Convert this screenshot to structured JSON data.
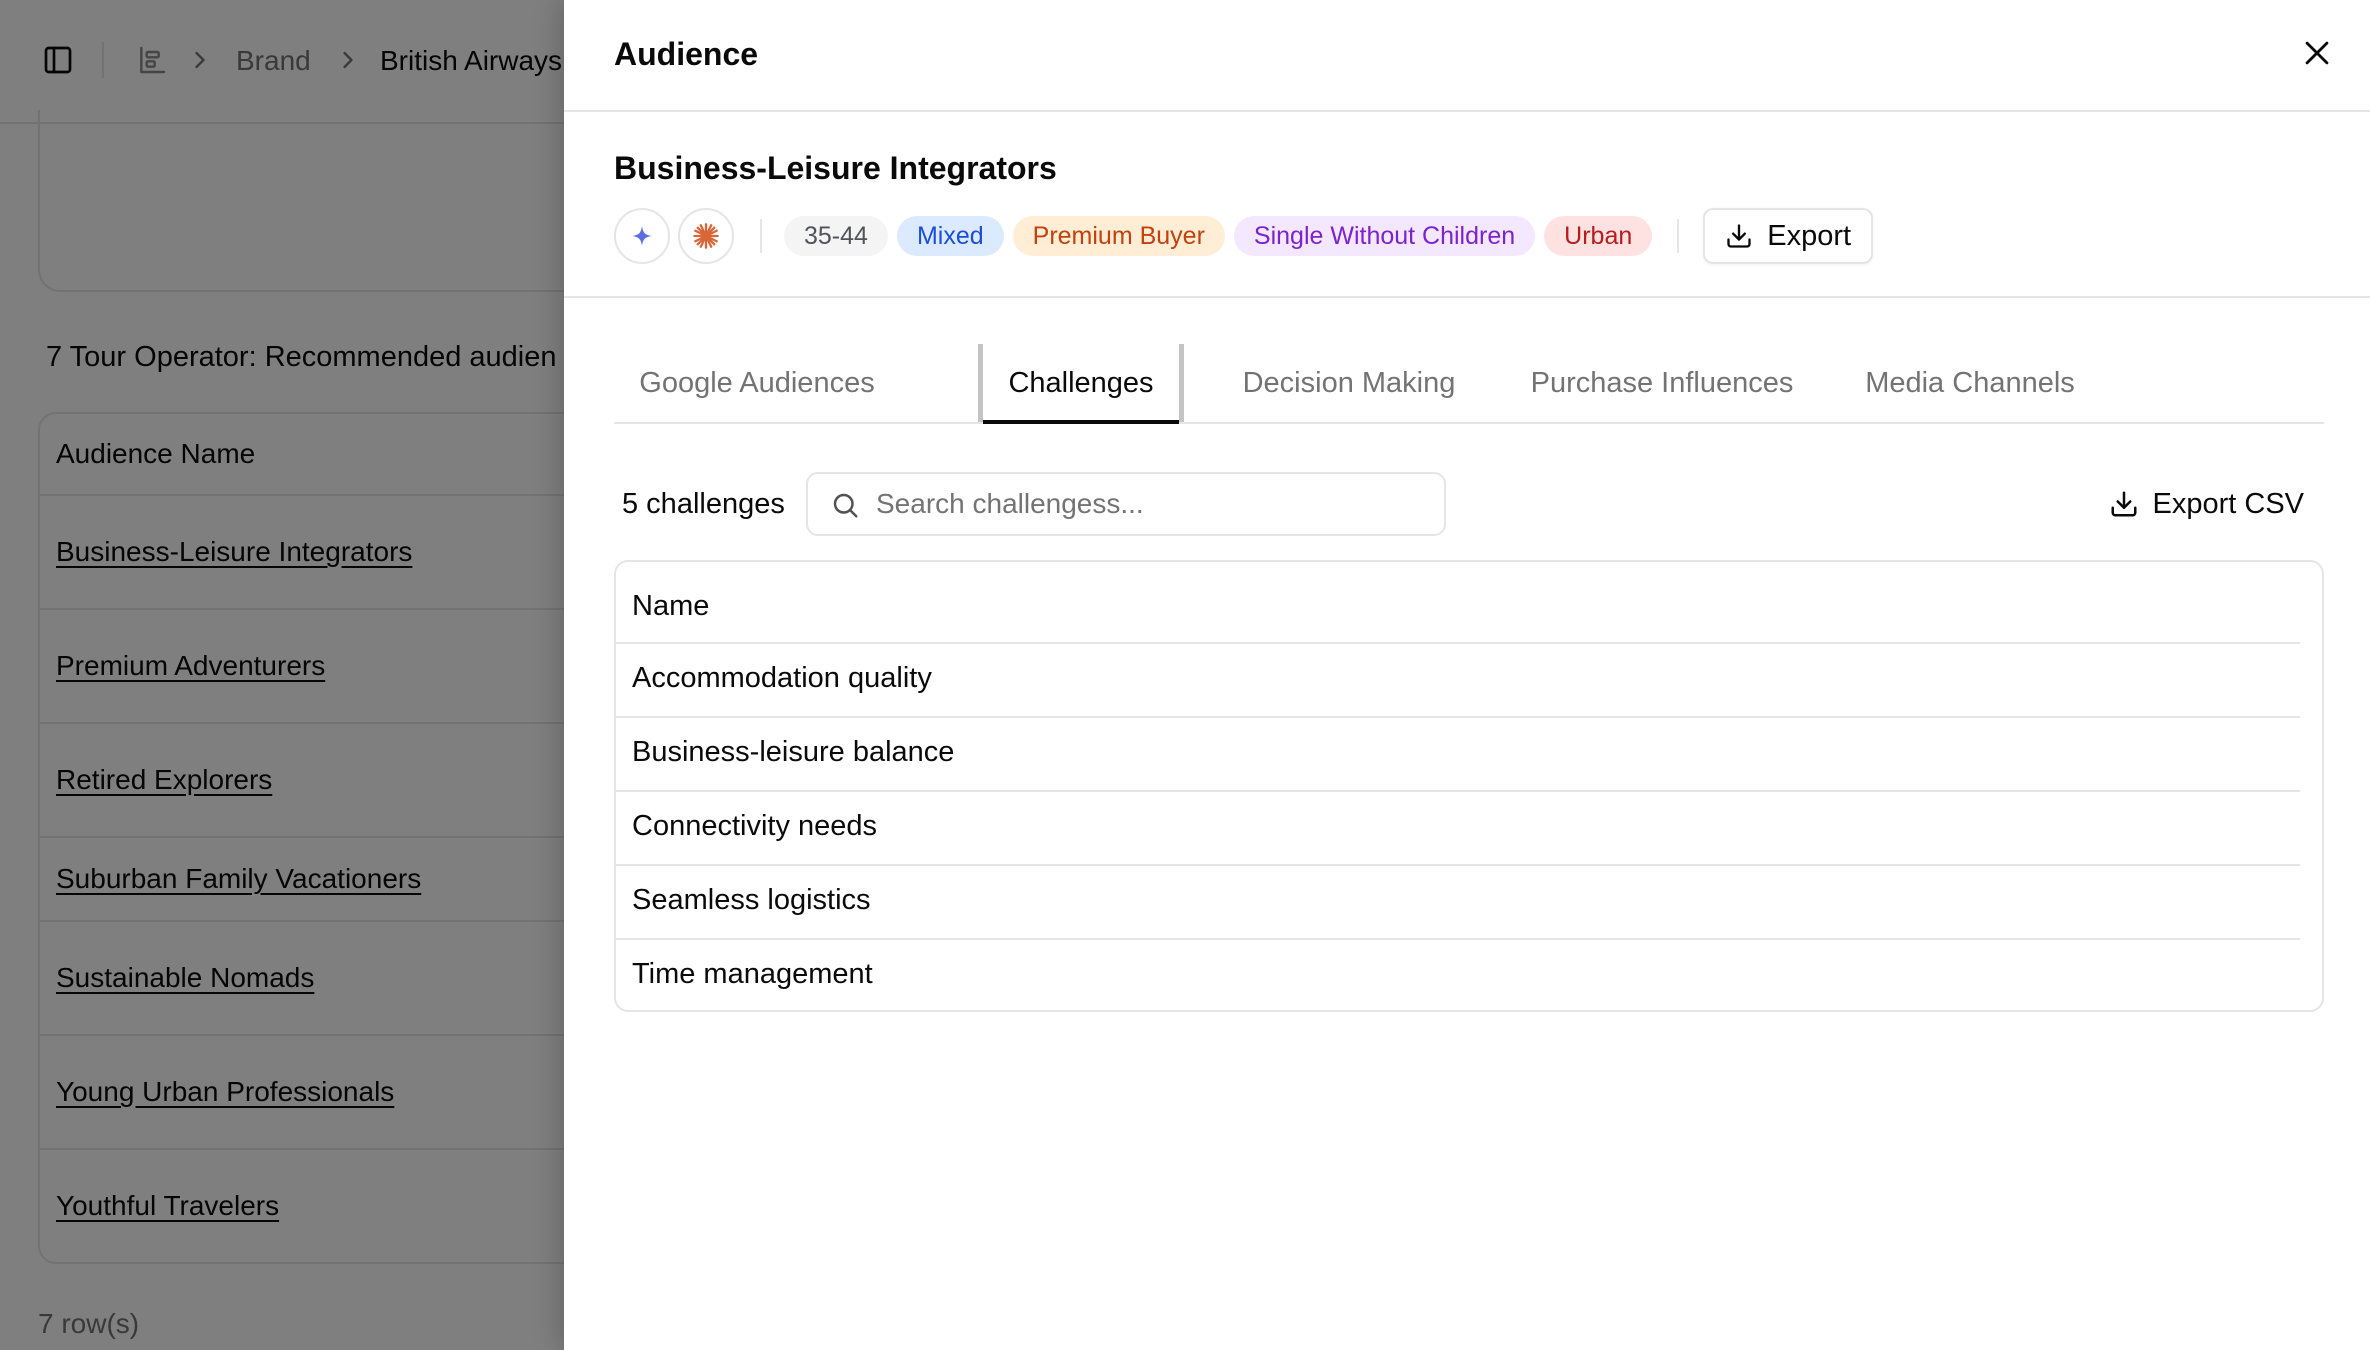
{
  "background": {
    "breadcrumb": {
      "brand": "Brand",
      "current": "British Airways"
    },
    "section_title": "7 Tour Operator: Recommended audien",
    "table": {
      "header": "Audience Name",
      "rows": [
        "Business-Leisure Integrators",
        "Premium Adventurers",
        "Retired Explorers",
        "Suburban Family Vacationers",
        "Sustainable Nomads",
        "Young Urban Professionals",
        "Youthful Travelers"
      ]
    },
    "footer": "7 row(s)"
  },
  "sheet": {
    "title": "Audience",
    "audience_name": "Business-Leisure Integrators",
    "tags": [
      "35-44",
      "Mixed",
      "Premium Buyer",
      "Single Without Children",
      "Urban"
    ],
    "export_label": "Export",
    "tabs": [
      "Google Audiences",
      "Challenges",
      "Decision Making",
      "Purchase Influences",
      "Media Channels"
    ],
    "active_tab": "Challenges",
    "count_label": "5 challenges",
    "search": {
      "placeholder": "Search challengess..."
    },
    "export_csv_label": "Export CSV",
    "table": {
      "header": "Name",
      "rows": [
        "Accommodation quality",
        "Business-leisure balance",
        "Connectivity needs",
        "Seamless logistics",
        "Time management"
      ]
    }
  },
  "colors": {
    "overlay": "rgba(0,0,0,0.5)",
    "tag_mixed": "#1d4ed8",
    "tag_premium": "#c2410c",
    "tag_single": "#7e22ce",
    "tag_urban": "#b91c1c",
    "sparkle_icon": "#5b6ee1",
    "burst_icon": "#d9663a"
  },
  "icons": [
    "sidebar-toggle-icon",
    "breadcrumb-chart-icon",
    "chevron-right-icon",
    "close-icon",
    "sparkle-icon",
    "burst-icon",
    "download-icon",
    "search-icon"
  ]
}
